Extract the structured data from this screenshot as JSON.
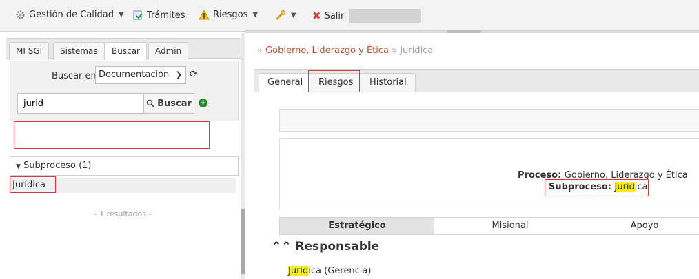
{
  "topbar": {
    "menus": [
      {
        "label": "Gestión de Calidad",
        "icon": "gear-icon",
        "has_dropdown": true
      },
      {
        "label": "Trámites",
        "icon": "forms-icon",
        "has_dropdown": false
      },
      {
        "label": "Riesgos",
        "icon": "warning-icon",
        "has_dropdown": true
      },
      {
        "label": "",
        "icon": "wrench-icon",
        "has_dropdown": true
      },
      {
        "label": "Salir",
        "icon": "close-x-icon",
        "has_dropdown": false
      }
    ]
  },
  "left_panel": {
    "tabs": [
      "MI SGI",
      "Sistemas",
      "Buscar",
      "Admin"
    ],
    "active_tab": "Buscar",
    "search": {
      "search_in_label": "Buscar en",
      "scope_selected": "Documentación",
      "query_value": "jurid",
      "button_label": "Buscar"
    },
    "results": {
      "group_label": "Subproceso (1)",
      "items": [
        "Jurídica"
      ],
      "count_text": "- 1 resultados -"
    }
  },
  "right_panel": {
    "breadcrumb": {
      "parent": "Gobierno, Liderazgo y Ética",
      "current": "Jurídica"
    },
    "tabs": [
      "General",
      "Riesgos",
      "Historial"
    ],
    "active_tab": "General",
    "info": {
      "proceso_label": "Proceso",
      "proceso_value": "Gobierno, Liderazgo y Ética",
      "subproceso_label": "Subproceso",
      "subproceso_highlight": "Jurid",
      "subproceso_rest": "ica"
    },
    "categories": [
      "Estratégico",
      "Misional",
      "Apoyo"
    ],
    "active_category": "Estratégico",
    "section_title": "Responsable",
    "responsable": {
      "highlight": "Jurid",
      "rest": "ica (Gerencia)"
    }
  },
  "colors": {
    "highlight": "#f5ee1a",
    "breadcrumb_link": "#bf4d2a",
    "annotation_box": "#d9363e",
    "add_button": "#1f8c24",
    "delete_x": "#d9363e"
  }
}
